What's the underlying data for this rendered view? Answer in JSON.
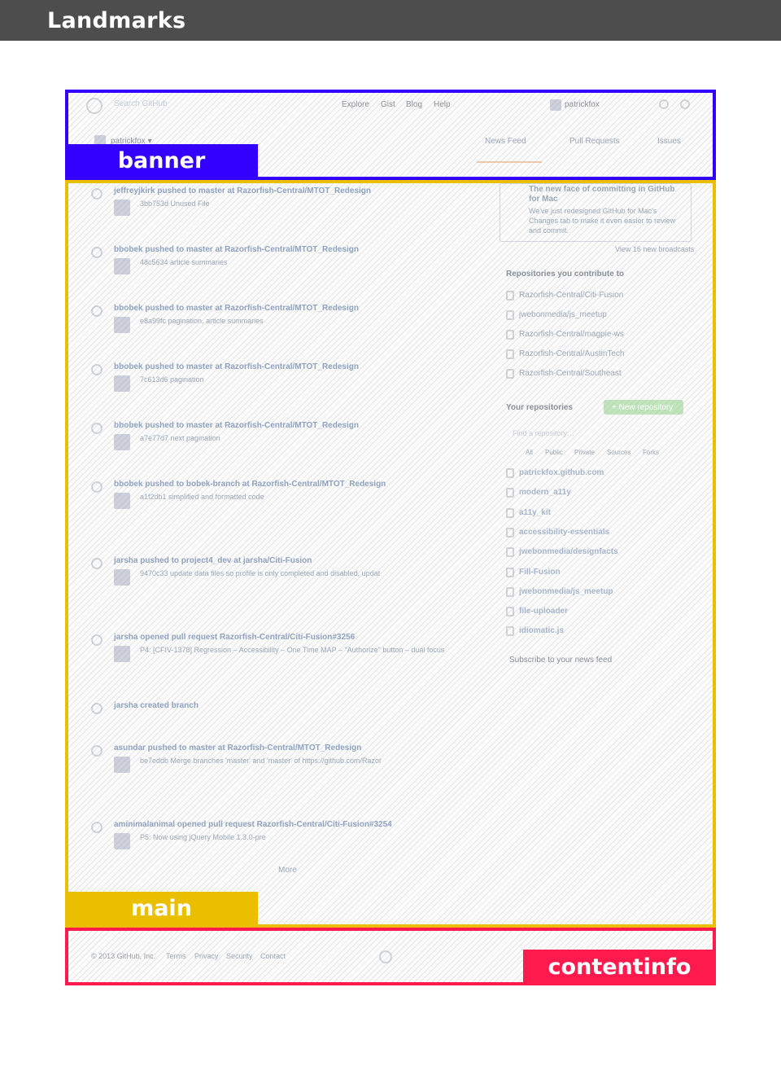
{
  "header": {
    "title": "Landmarks"
  },
  "regions": {
    "banner": {
      "label": "banner",
      "color": "#3300ff"
    },
    "main": {
      "label": "main",
      "color": "#eabf00"
    },
    "contentinfo": {
      "label": "contentinfo",
      "color": "#ff1a4d"
    }
  },
  "screenshot": {
    "nav": {
      "search_placeholder": "Search GitHub",
      "links": [
        "Explore",
        "Gist",
        "Blog",
        "Help"
      ],
      "user": "patrickfox",
      "context_user": "patrickfox ▾",
      "tabs": [
        "News Feed",
        "Pull Requests",
        "Issues"
      ]
    },
    "feed": [
      {
        "text": "jeffreyjkirk pushed to master at Razorfish-Central/MTOT_Redesign",
        "detail": "3bb753d Unused File"
      },
      {
        "text": "bbobek pushed to master at Razorfish-Central/MTOT_Redesign",
        "detail": "48c5634 article summaries"
      },
      {
        "text": "bbobek pushed to master at Razorfish-Central/MTOT_Redesign",
        "detail": "e8a99fc pagination, article summaries"
      },
      {
        "text": "bbobek pushed to master at Razorfish-Central/MTOT_Redesign",
        "detail": "7c613d6 pagination"
      },
      {
        "text": "bbobek pushed to master at Razorfish-Central/MTOT_Redesign",
        "detail": "a7e77d7 next pagination"
      },
      {
        "text": "bbobek pushed to bobek-branch at Razorfish-Central/MTOT_Redesign",
        "detail": "a1f2db1 simplified and formatted code"
      },
      {
        "text": "jarsha pushed to project4_dev at jarsha/Citi-Fusion",
        "detail": "9470c33 update data files so profile is only completed and disabled, updat"
      },
      {
        "text": "jarsha opened pull request Razorfish-Central/Citi-Fusion#3256",
        "detail": "P4: [CFIV-1378] Regression – Accessibility – One Time MAP – \"Authorize\" button – dual focus"
      },
      {
        "text": "jarsha created branch",
        "detail": ""
      },
      {
        "text": "asundar pushed to master at Razorfish-Central/MTOT_Redesign",
        "detail": "be7eddb Merge branches 'master' and 'master' of https://github.com/Razor"
      },
      {
        "text": "aminimalanimal opened pull request Razorfish-Central/Citi-Fusion#3254",
        "detail": "P5: Now using jQuery Mobile 1.3.0-pre"
      }
    ],
    "more": "More",
    "sidebar": {
      "promo_title": "The new face of committing in GitHub for Mac",
      "promo_text": "We've just redesigned GitHub for Mac's Changes tab to make it even easier to review and commit.",
      "broadcasts": "View 16 new broadcasts",
      "contribute_heading": "Repositories you contribute to",
      "contribute": [
        "Razorfish-Central/Citi-Fusion",
        "jwebonmedia/js_meetup",
        "Razorfish-Central/magpie-ws",
        "Razorfish-Central/AustinTech",
        "Razorfish-Central/Southeast"
      ],
      "your_heading": "Your repositories",
      "new_repo": "+ New repository",
      "find_placeholder": "Find a repository…",
      "filters": [
        "All",
        "Public",
        "Private",
        "Sources",
        "Forks"
      ],
      "repos": [
        "patrickfox.github.com",
        "modern_a11y",
        "a11y_kit",
        "accessibility-essentials",
        "jwebonmedia/designfacts",
        "Fill-Fusion",
        "jwebonmedia/js_meetup",
        "file-uploader",
        "idiomatic.js"
      ],
      "subscribe": "Subscribe to your news feed"
    },
    "footer": {
      "copyright": "© 2013 GitHub, Inc.",
      "links": [
        "Terms",
        "Privacy",
        "Security",
        "Contact"
      ]
    }
  }
}
